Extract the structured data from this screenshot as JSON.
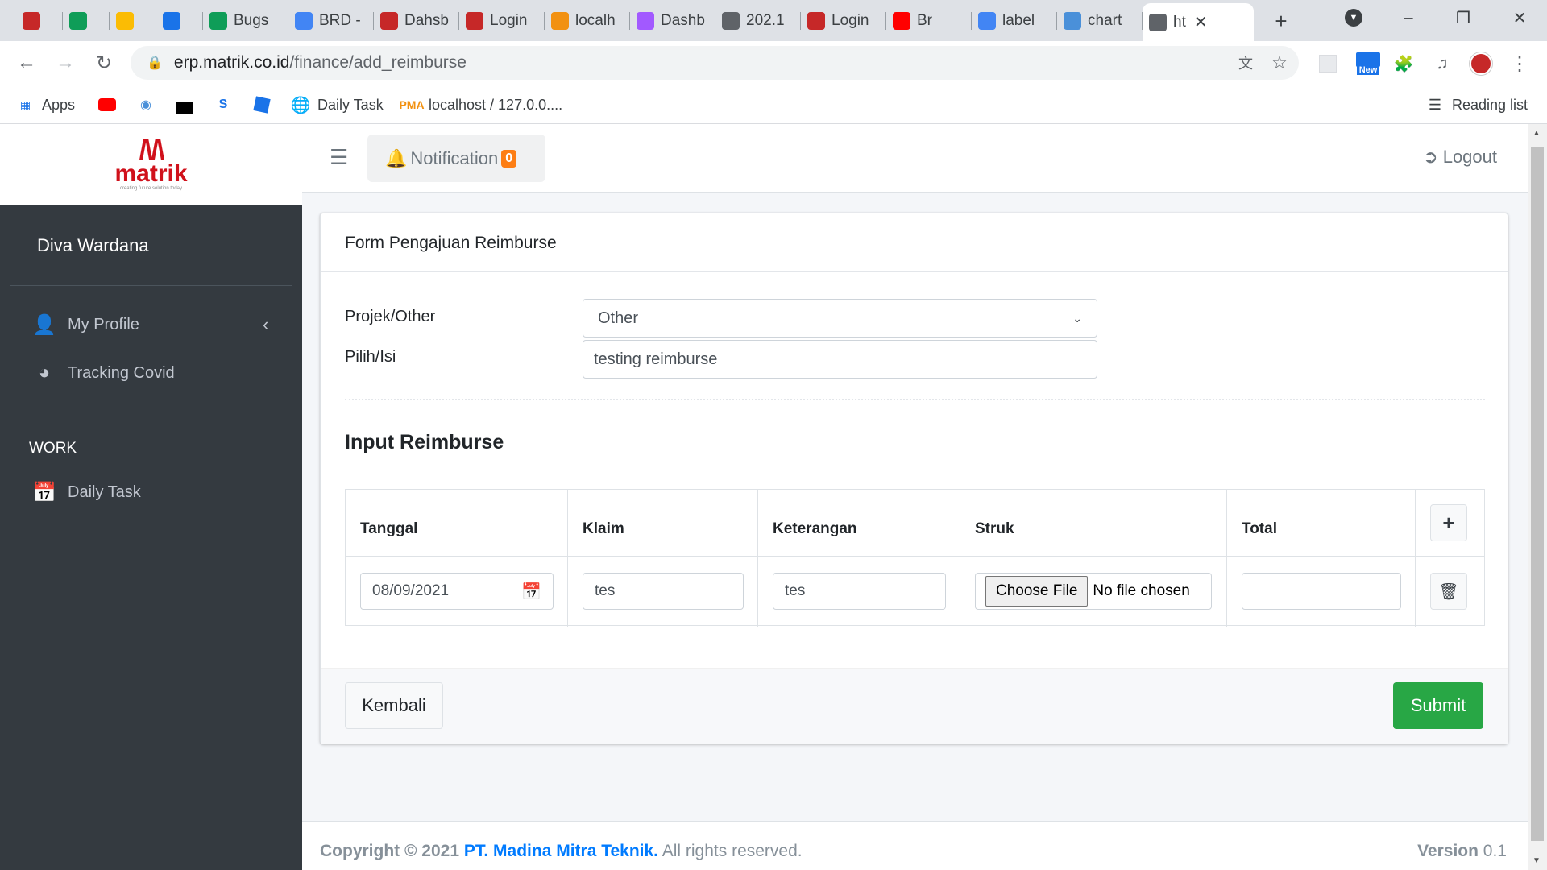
{
  "browser": {
    "tabs": [
      {
        "label": "",
        "icon": "matrik-icon",
        "color": "#c62828"
      },
      {
        "label": "",
        "icon": "sheets-icon",
        "color": "#0f9d58"
      },
      {
        "label": "",
        "icon": "drive-icon",
        "color": "#fbbc04"
      },
      {
        "label": "",
        "icon": "drive-icon",
        "color": "#1a73e8"
      },
      {
        "label": "Bugs",
        "icon": "sheets-icon",
        "color": "#0f9d58"
      },
      {
        "label": "BRD -",
        "icon": "docs-icon",
        "color": "#4285f4"
      },
      {
        "label": "Dahsb",
        "icon": "matrik-icon",
        "color": "#c62828"
      },
      {
        "label": "Login",
        "icon": "matrik-icon",
        "color": "#c62828"
      },
      {
        "label": "localh",
        "icon": "phpmyadmin-icon",
        "color": "#f29111"
      },
      {
        "label": "Dashb",
        "icon": "figma-icon",
        "color": "#a259ff"
      },
      {
        "label": "202.1",
        "icon": "globe-icon",
        "color": "#5f6368"
      },
      {
        "label": "Login",
        "icon": "matrik-icon",
        "color": "#c62828"
      },
      {
        "label": "Br",
        "icon": "youtube-icon",
        "color": "#ff0000"
      },
      {
        "label": "label",
        "icon": "google-icon",
        "color": "#4285f4"
      },
      {
        "label": "chart",
        "icon": "cloud-icon",
        "color": "#4a90d9"
      },
      {
        "label": "ht",
        "icon": "globe-icon",
        "color": "#5f6368"
      }
    ],
    "url_host": "erp.matrik.co.id",
    "url_path": "/finance/add_reimburse",
    "bookmarks": {
      "apps": "Apps",
      "daily_task": "Daily Task",
      "localhost": "localhost / 127.0.0....",
      "reading_list": "Reading list"
    },
    "ext_new_badge": "New"
  },
  "sidebar": {
    "logo_text": "matrik",
    "logo_tagline": "creating future solution today",
    "user_name": "Diva Wardana",
    "items": [
      {
        "label": "My Profile",
        "icon": "user-icon"
      },
      {
        "label": "Tracking Covid",
        "icon": "chart-pie-icon"
      }
    ],
    "section_header": "WORK",
    "work_items": [
      {
        "label": "Daily Task",
        "icon": "calendar-check-icon"
      }
    ]
  },
  "topnav": {
    "notification_label": "Notification",
    "notification_count": "0",
    "logout_label": "Logout"
  },
  "form": {
    "title": "Form Pengajuan Reimburse",
    "projek_label": "Projek/Other",
    "projek_value": "Other",
    "pilih_label": "Pilih/Isi",
    "pilih_value": "testing reimburse",
    "section_title": "Input Reimburse",
    "columns": [
      "Tanggal",
      "Klaim",
      "Keterangan",
      "Struk",
      "Total"
    ],
    "row": {
      "tanggal": "08/09/2021",
      "klaim": "tes",
      "keterangan": "tes",
      "file_button": "Choose File",
      "file_status": "No file chosen",
      "total": ""
    },
    "back_label": "Kembali",
    "submit_label": "Submit"
  },
  "footer": {
    "copyright": "Copyright © 2021",
    "company": "PT. Madina Mitra Teknik.",
    "rights": "All rights reserved.",
    "version_label": "Version",
    "version_value": "0.1"
  },
  "colors": {
    "sidebar_bg": "#343a40",
    "submit_green": "#28a745",
    "badge_orange": "#fd7e14",
    "link_blue": "#007bff",
    "brand_red": "#d0111b"
  }
}
